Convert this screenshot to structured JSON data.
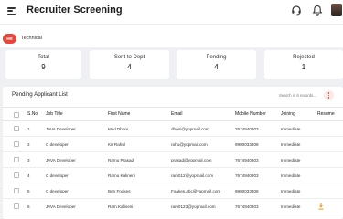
{
  "header": {
    "title": "Recruiter Screening"
  },
  "tabs": [
    {
      "label": "HR",
      "active": true
    },
    {
      "label": "Technical",
      "active": false
    }
  ],
  "stats": [
    {
      "label": "Total",
      "value": "9"
    },
    {
      "label": "Sent to Dept",
      "value": "4"
    },
    {
      "label": "Pending",
      "value": "4"
    },
    {
      "label": "Rejected",
      "value": "1"
    }
  ],
  "list": {
    "title": "Pending Applicant List",
    "search_placeholder": "Search in 6 records...",
    "columns": [
      "S.No",
      "Job Title",
      "First Name",
      "Email",
      "Mobile Number",
      "Joining",
      "Resume"
    ],
    "rows": [
      {
        "sno": "1",
        "job": "JAVA Developer",
        "first": "Msd Dhoni",
        "email": "dhoni@yopmail.com",
        "mobile": "7674940303",
        "joining": "Immediate",
        "resume": false
      },
      {
        "sno": "2",
        "job": "C developer",
        "first": "Kir Rahul",
        "email": "rahu@yopmail.com",
        "mobile": "9900033308",
        "joining": "Immediate",
        "resume": false
      },
      {
        "sno": "3",
        "job": "JAVA Developer",
        "first": "Ramu Prasad",
        "email": "prasad@yopmail.com",
        "mobile": "7674940303",
        "joining": "Immediate",
        "resume": false
      },
      {
        "sno": "4",
        "job": "C developer",
        "first": "Ramu Kalineni",
        "email": "ram012@yopmail.com",
        "mobile": "7674940303",
        "joining": "Immediate",
        "resume": false
      },
      {
        "sno": "5",
        "job": "C developer",
        "first": "Ben Foakes",
        "email": "Foakes.abc@yopmail.com",
        "mobile": "9900033308",
        "joining": "Immediate",
        "resume": false
      },
      {
        "sno": "6",
        "job": "JAVA Developer",
        "first": "Ram Kalineni",
        "email": "ram0123@yopmail.com",
        "mobile": "7674940303",
        "joining": "Immediate",
        "resume": true
      }
    ]
  },
  "colors": {
    "accent": "#e8453c",
    "resume_icon": "#f0a030"
  }
}
